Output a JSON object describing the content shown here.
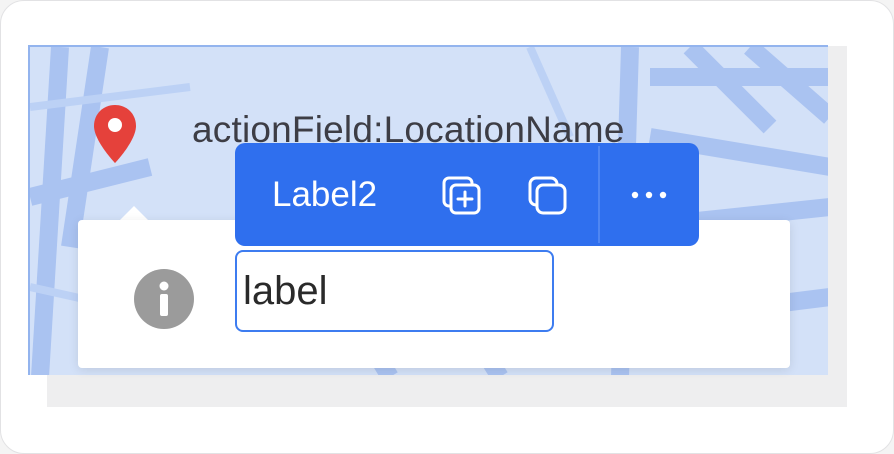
{
  "location": {
    "title": "actionField:LocationName",
    "pin_icon": "location-pin-icon",
    "pin_color": "#e5413b"
  },
  "toolbar": {
    "label": "Label2",
    "add_icon": "add-copy-icon",
    "copy_icon": "copy-icon",
    "more_icon": "more-horizontal-icon",
    "color": "#2f6fee"
  },
  "field": {
    "info_icon": "info-icon",
    "value": "label"
  },
  "colors": {
    "map_background": "#c7d8f5",
    "map_roads": "#a9c3f0",
    "input_border": "#3d7cf0"
  }
}
